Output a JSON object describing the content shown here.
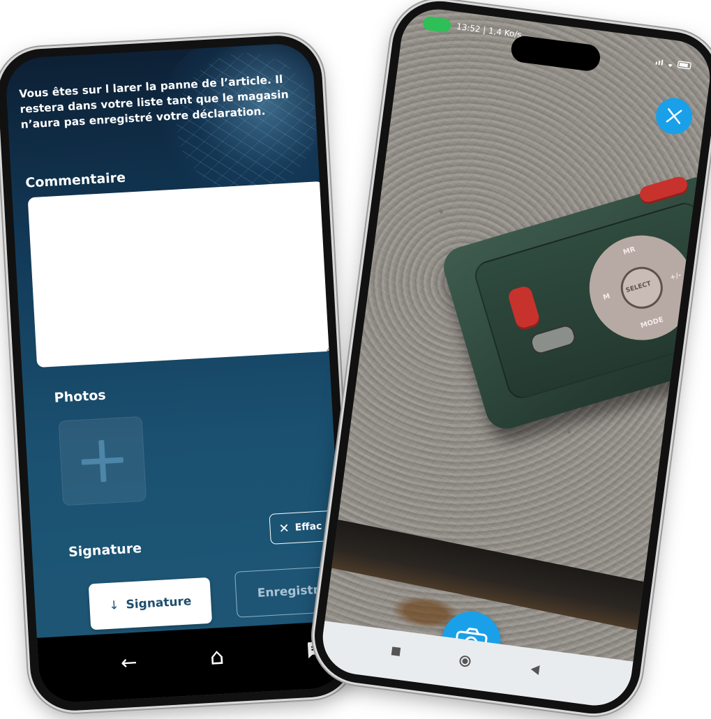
{
  "left_phone": {
    "intro_text": "Vous êtes sur l                         larer la panne de l’article. Il restera dans votre liste tant que le magasin n’aura pas enregistré votre déclaration.",
    "comment_section": {
      "title": "Commentaire",
      "value": ""
    },
    "photos_section": {
      "title": "Photos"
    },
    "signature_section": {
      "title": "Signature",
      "clear_label": "Effac"
    },
    "actions": {
      "signature_label": "Signature",
      "save_label": "Enregistre"
    },
    "navbar": {
      "back_icon": "←",
      "home_icon": "⌂",
      "messages_icon": "message-icon"
    },
    "colors": {
      "bg_top": "#0d2035",
      "bg_bottom": "#1d5a7a",
      "button_text": "#1e4e6e"
    }
  },
  "right_phone": {
    "status_bar": {
      "time_text": "13:52 | 1,4 Ko/s"
    },
    "device_labels": {
      "key_top": "MR",
      "key_left": "M",
      "key_right": "+/-",
      "key_center": "SELECT",
      "key_bottom": "MODE"
    },
    "accent_color": "#1aa0e8"
  }
}
